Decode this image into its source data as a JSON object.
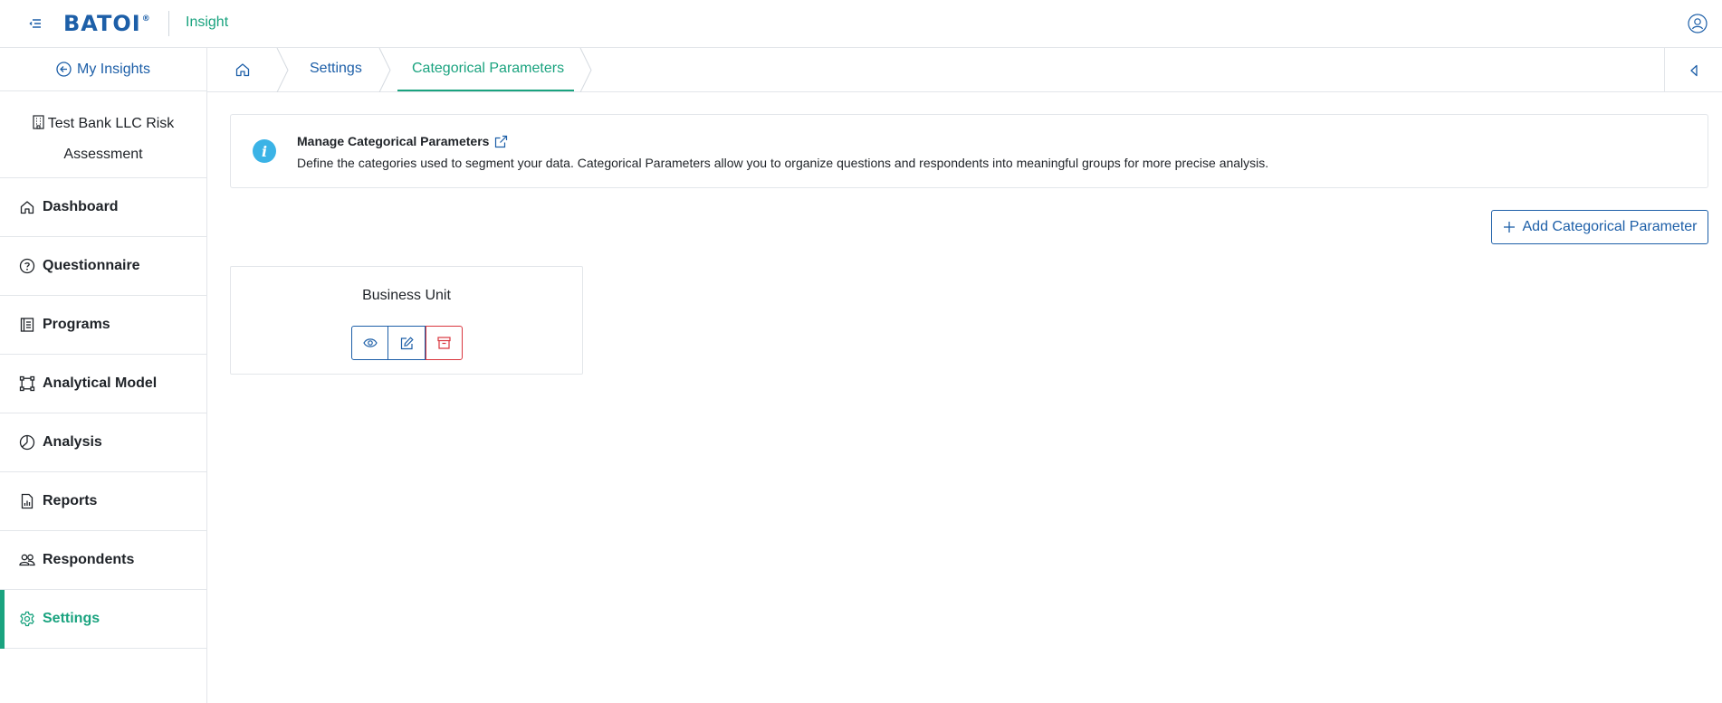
{
  "header": {
    "logo_text": "BATOI",
    "logo_reg": "®",
    "app_name": "Insight",
    "menu_icon": "menu-toggle-icon",
    "user_icon": "user-avatar-icon"
  },
  "sidebar": {
    "back_label": "My Insights",
    "project_name": "Test Bank LLC Risk Assessment",
    "items": [
      {
        "label": "Dashboard",
        "icon": "home-icon",
        "active": false
      },
      {
        "label": "Questionnaire",
        "icon": "question-circle-icon",
        "active": false
      },
      {
        "label": "Programs",
        "icon": "book-icon",
        "active": false
      },
      {
        "label": "Analytical Model",
        "icon": "model-nodes-icon",
        "active": false
      },
      {
        "label": "Analysis",
        "icon": "pie-chart-icon",
        "active": false
      },
      {
        "label": "Reports",
        "icon": "report-icon",
        "active": false
      },
      {
        "label": "Respondents",
        "icon": "users-icon",
        "active": false
      },
      {
        "label": "Settings",
        "icon": "gear-icon",
        "active": true
      }
    ]
  },
  "breadcrumb": {
    "home_icon": "home-icon",
    "items": [
      {
        "label": "Settings"
      },
      {
        "label": "Categorical Parameters",
        "current": true
      }
    ]
  },
  "info": {
    "title": "Manage Categorical Parameters",
    "description": "Define the categories used to segment your data. Categorical Parameters allow you to organize questions and respondents into meaningful groups for more precise analysis."
  },
  "actions": {
    "add_label": "Add Categorical Parameter"
  },
  "parameters": [
    {
      "name": "Business Unit"
    }
  ],
  "colors": {
    "brand_blue": "#1d5fa8",
    "accent_green": "#1aa37f",
    "danger_red": "#d9363e",
    "info_blue": "#3bb3e6"
  }
}
